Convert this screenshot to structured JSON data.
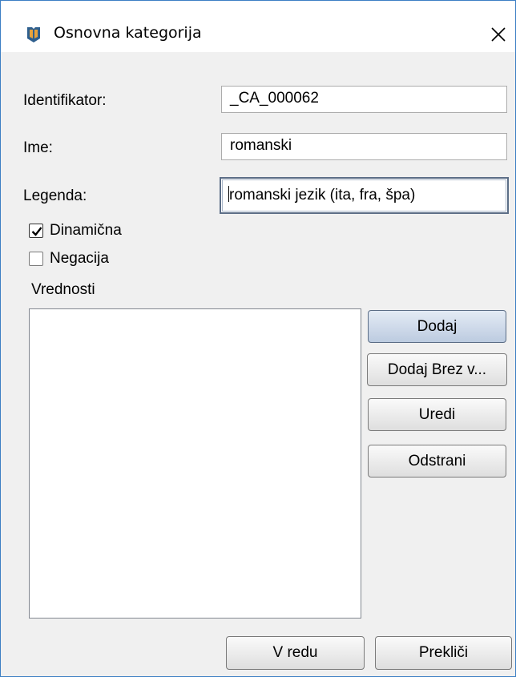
{
  "window": {
    "title": "Osnovna kategorija",
    "icon": "book-shield-icon",
    "close_icon": "close-icon"
  },
  "form": {
    "identifier_label": "Identifikator:",
    "identifier_value": "_CA_000062",
    "name_label": "Ime:",
    "name_value": "romanski",
    "legend_label": "Legenda:",
    "legend_value": "romanski jezik (ita, fra, špa)"
  },
  "checkboxes": {
    "dynamic": {
      "label": "Dinamična",
      "checked": true
    },
    "negation": {
      "label": "Negacija",
      "checked": false
    }
  },
  "values_section": {
    "label": "Vrednosti",
    "items": [],
    "buttons": {
      "add": "Dodaj",
      "add_without": "Dodaj Brez v...",
      "edit": "Uredi",
      "remove": "Odstrani"
    }
  },
  "footer": {
    "ok": "V redu",
    "cancel": "Prekliči"
  },
  "colors": {
    "window_border": "#3d7fc4",
    "dialog_bg": "#f0f0f0",
    "primary_button": "#c9d6e8",
    "focus_border": "#5b6d86"
  }
}
